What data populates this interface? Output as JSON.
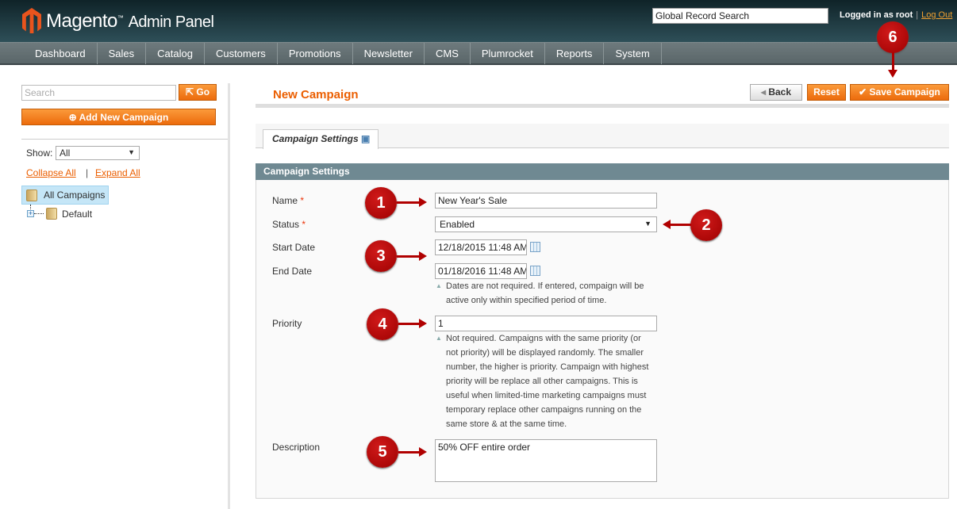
{
  "header": {
    "logo_word": "Magento",
    "logo_suffix": "Admin Panel",
    "global_search": "Global Record Search",
    "logged_in": "Logged in as root",
    "sep": "|",
    "logout": "Log Out"
  },
  "nav": [
    "Dashboard",
    "Sales",
    "Catalog",
    "Customers",
    "Promotions",
    "Newsletter",
    "CMS",
    "Plumrocket",
    "Reports",
    "System"
  ],
  "sidebar": {
    "search_placeholder": "Search",
    "go": "Go",
    "add": "Add New Campaign",
    "show_label": "Show:",
    "show_value": "All",
    "collapse": "Collapse All",
    "pipe": "|",
    "expand": "Expand All",
    "tree": [
      "All Campaigns",
      "Default"
    ]
  },
  "page": {
    "title": "New Campaign",
    "back": "Back",
    "reset": "Reset",
    "save": "Save Campaign",
    "tab": "Campaign Settings",
    "fieldset": "Campaign Settings"
  },
  "form": {
    "name_label": "Name",
    "name": "New Year's Sale",
    "star": "*",
    "status_label": "Status",
    "status": "Enabled",
    "start_label": "Start Date",
    "start": "12/18/2015 11:48 AM",
    "end_label": "End Date",
    "end": "01/18/2016 11:48 AM",
    "dates_note": "Dates are not required. If entered, compaign will be active only within specified period of time.",
    "priority_label": "Priority",
    "priority": "1",
    "priority_note": "Not required. Campaigns with the same priority (or not priority) will be displayed randomly. The smaller number, the higher is priority. Campaign with highest priority will be replace all other campaigns. This is useful when limited-time marketing campaigns must temporary replace other campaigns running on the same store & at the same time.",
    "desc_label": "Description",
    "desc": "50% OFF entire order"
  },
  "markers": [
    "1",
    "2",
    "3",
    "4",
    "5",
    "6"
  ],
  "colors": {
    "accent": "#eb5e00",
    "marker": "#b00000",
    "fieldset_header": "#6f8992"
  }
}
